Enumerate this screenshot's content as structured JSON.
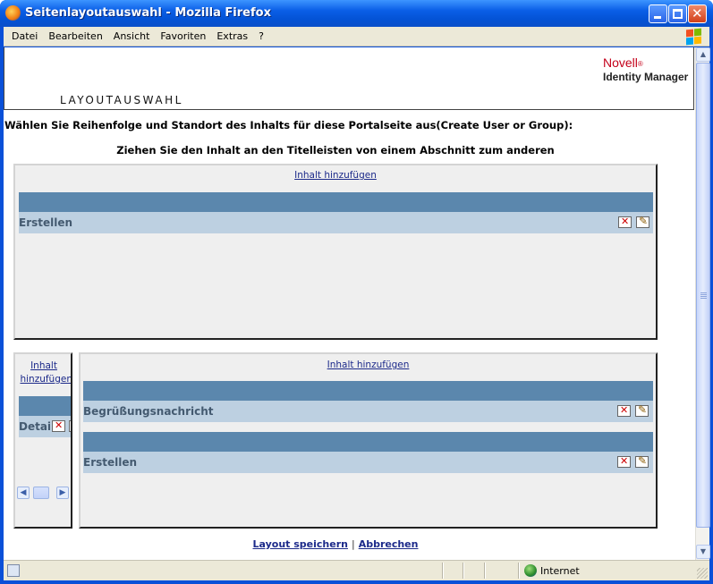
{
  "window": {
    "title": "Seitenlayoutauswahl - Mozilla Firefox"
  },
  "menu": {
    "items": [
      "Datei",
      "Bearbeiten",
      "Ansicht",
      "Favoriten",
      "Extras",
      "?"
    ]
  },
  "header": {
    "brand": "Novell",
    "brand_mark": "®",
    "product": "Identity Manager",
    "page_title": "LAYOUTAUSWAHL"
  },
  "instructions": {
    "line1": "Wählen Sie Reihenfolge und Standort des Inhalts für diese Portalseite aus(Create User or Group):",
    "line2": "Ziehen Sie den Inhalt an den Titelleisten von einem Abschnitt zum anderen"
  },
  "sections": {
    "top": {
      "add_label": "Inhalt hinzufügen",
      "items": [
        {
          "label": "Erstellen"
        }
      ]
    },
    "left": {
      "add_label_line1": "Inhalt",
      "add_label_line2": "hinzufügen",
      "items": [
        {
          "label": "Detail"
        }
      ]
    },
    "right": {
      "add_label": "Inhalt hinzufügen",
      "items": [
        {
          "label": "Begrüßungsnachricht"
        },
        {
          "label": "Erstellen"
        }
      ]
    }
  },
  "footer": {
    "save_label": "Layout speichern",
    "separator": "|",
    "cancel_label": "Abbrechen"
  },
  "statusbar": {
    "zone": "Internet"
  },
  "icons": {
    "delete": "delete-icon",
    "edit": "edit-icon",
    "zone": "globe-icon",
    "app": "firefox-icon"
  },
  "colors": {
    "titlebar": "#0a5ee6",
    "section_bar": "#5b87ad",
    "item_bar": "#bdd0e1",
    "section_bg": "#efefef",
    "link": "#1c2a8a",
    "brand_red": "#c4001a"
  }
}
